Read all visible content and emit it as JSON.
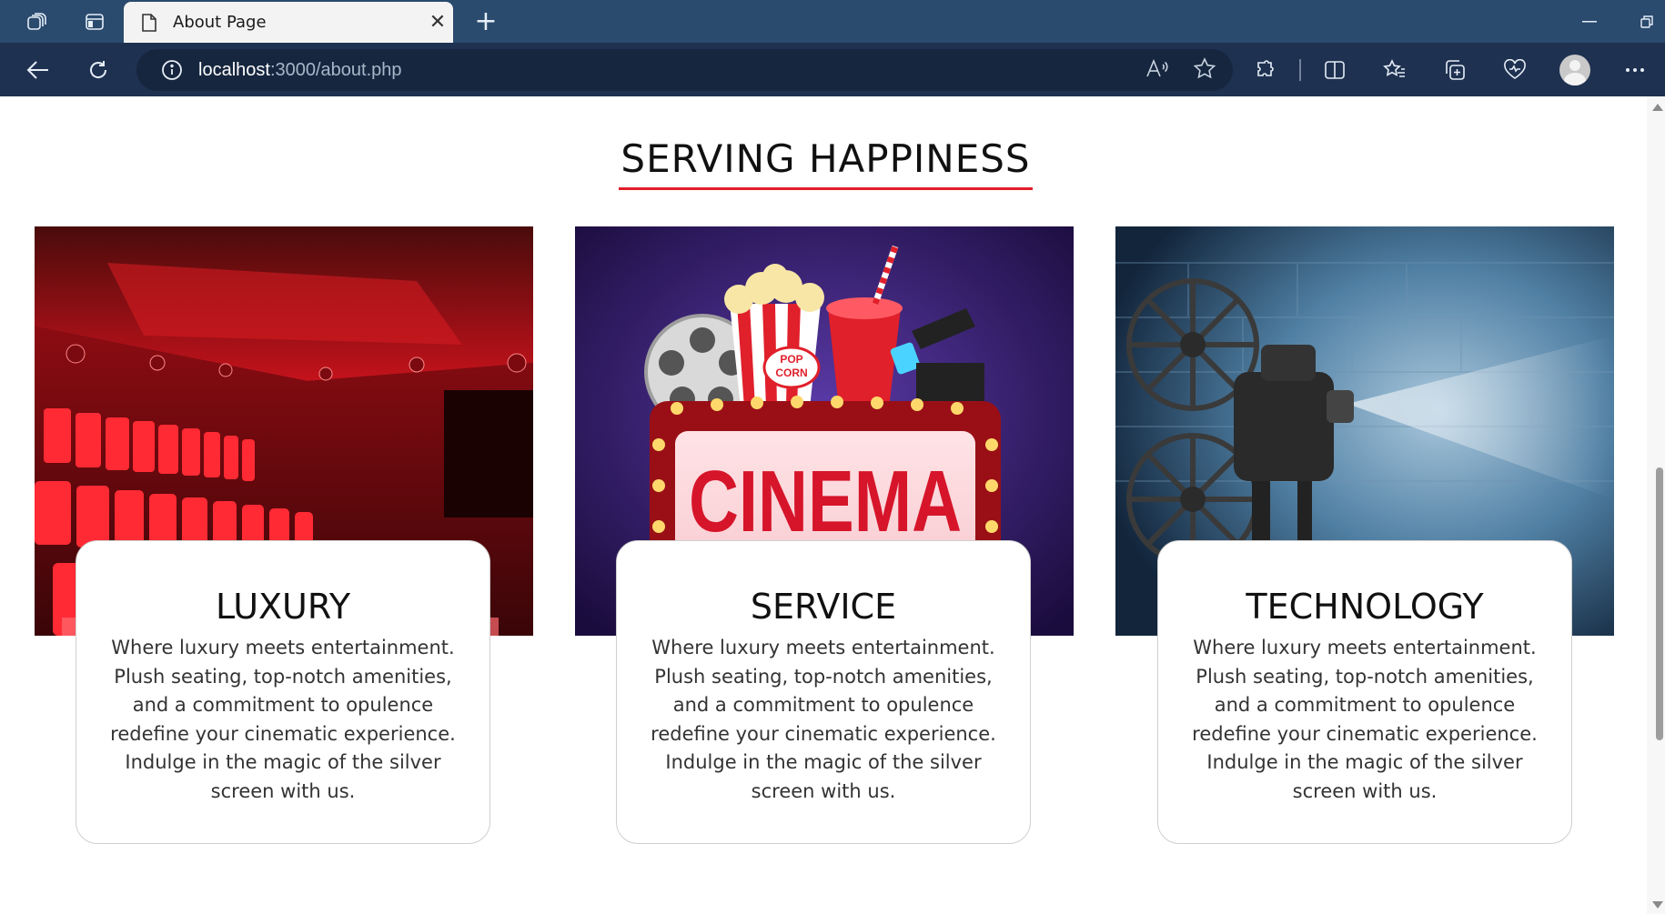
{
  "browser": {
    "tab_title": "About Page",
    "url_host": "localhost",
    "url_rest": ":3000/about.php"
  },
  "page": {
    "heading": "SERVING HAPPINESS",
    "accent_color": "#e11d2a"
  },
  "cards": [
    {
      "title": "LUXURY",
      "description": "Where luxury meets entertainment. Plush seating, top-notch amenities, and a commitment to opulence redefine your cinematic experience. Indulge in the magic of the silver screen with us.",
      "image": "red-cinema-hall"
    },
    {
      "title": "SERVICE",
      "description": "Where luxury meets entertainment. Plush seating, top-notch amenities, and a commitment to opulence redefine your cinematic experience. Indulge in the magic of the silver screen with us.",
      "image": "cinema-marquee-popcorn",
      "image_text": "CINEMA",
      "popcorn_text": "POP CORN"
    },
    {
      "title": "TECHNOLOGY",
      "description": "Where luxury meets entertainment. Plush seating, top-notch amenities, and a commitment to opulence redefine your cinematic experience. Indulge in the magic of the silver screen with us.",
      "image": "film-projector"
    }
  ]
}
